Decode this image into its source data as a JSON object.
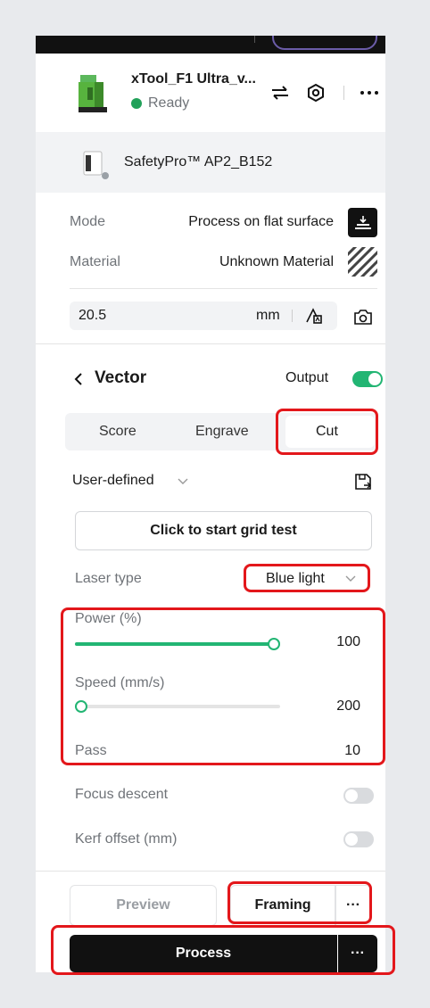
{
  "device": {
    "name": "xTool_F1 Ultra_v...",
    "status": "Ready",
    "status_color": "#22a15a",
    "icons": [
      "switch-device-icon",
      "settings-icon",
      "more-icon"
    ]
  },
  "accessory": {
    "name": "SafetyPro™ AP2_B152"
  },
  "mode": {
    "label": "Mode",
    "value": "Process on flat surface"
  },
  "material": {
    "label": "Material",
    "value": "Unknown Material"
  },
  "thickness": {
    "value": "20.5",
    "unit": "mm"
  },
  "layer": {
    "title": "Vector",
    "output_label": "Output",
    "output_on": true
  },
  "tabs": [
    {
      "label": "Score",
      "selected": false
    },
    {
      "label": "Engrave",
      "selected": false
    },
    {
      "label": "Cut",
      "selected": true
    }
  ],
  "preset": {
    "label": "User-defined"
  },
  "grid_test": {
    "label": "Click to start grid test"
  },
  "laser_type": {
    "label": "Laser type",
    "value": "Blue light"
  },
  "power": {
    "label": "Power (%)",
    "value": "100",
    "fraction": 1.0
  },
  "speed": {
    "label": "Speed (mm/s)",
    "value": "200",
    "fraction": 0.0
  },
  "pass": {
    "label": "Pass",
    "value": "10"
  },
  "focus_descent": {
    "label": "Focus descent",
    "on": false
  },
  "kerf_offset": {
    "label": "Kerf offset (mm)",
    "on": false
  },
  "actions": {
    "preview": "Preview",
    "framing": "Framing",
    "framing_more": "···",
    "process": "Process",
    "process_more": "···"
  },
  "colors": {
    "accent": "#22b573",
    "highlight": "#e3171b",
    "process_bg": "#111111"
  }
}
